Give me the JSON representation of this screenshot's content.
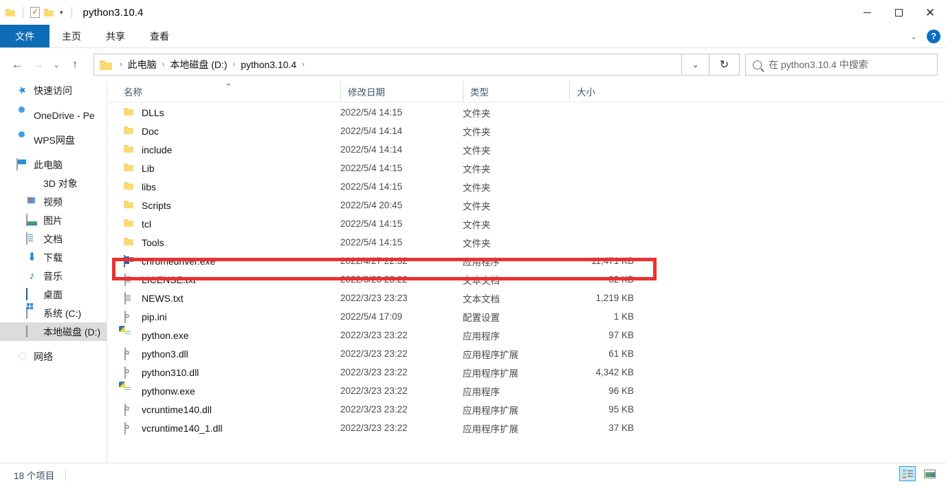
{
  "window": {
    "title": "python3.10.4",
    "quick_access": [
      {
        "name": "folder-icon",
        "label": ""
      },
      {
        "name": "properties-icon",
        "label": ""
      },
      {
        "name": "new-folder-icon",
        "label": ""
      },
      {
        "name": "customize-caret-icon",
        "label": "▾"
      }
    ],
    "controls": {
      "minimize": "—",
      "maximize": "▢",
      "close": "✕"
    }
  },
  "ribbon": {
    "tabs": [
      {
        "label": "文件",
        "active": true
      },
      {
        "label": "主页",
        "active": false
      },
      {
        "label": "共享",
        "active": false
      },
      {
        "label": "查看",
        "active": false
      }
    ],
    "expand_caret": "⌄",
    "help_label": "?"
  },
  "navigation": {
    "back": "←",
    "forward": "→",
    "recent": "⌄",
    "up": "↑",
    "breadcrumbs": [
      "此电脑",
      "本地磁盘 (D:)",
      "python3.10.4"
    ],
    "separator": "›",
    "address_caret": "⌄",
    "refresh": "↻"
  },
  "search": {
    "placeholder": "在 python3.10.4 中搜索"
  },
  "sidebar": {
    "items": [
      {
        "label": "快速访问",
        "icon": "star-icon",
        "indent": 0,
        "selected": false
      },
      {
        "label": "OneDrive - Pe",
        "icon": "onedrive-cloud-icon",
        "indent": 0,
        "selected": false
      },
      {
        "label": "WPS网盘",
        "icon": "wps-cloud-icon",
        "indent": 0,
        "selected": false
      },
      {
        "label": "此电脑",
        "icon": "this-pc-icon",
        "indent": 0,
        "selected": false
      },
      {
        "label": "3D 对象",
        "icon": "3d-objects-icon",
        "indent": 1,
        "selected": false
      },
      {
        "label": "视频",
        "icon": "videos-icon",
        "indent": 1,
        "selected": false
      },
      {
        "label": "图片",
        "icon": "pictures-icon",
        "indent": 1,
        "selected": false
      },
      {
        "label": "文档",
        "icon": "documents-icon",
        "indent": 1,
        "selected": false
      },
      {
        "label": "下载",
        "icon": "downloads-icon",
        "indent": 1,
        "selected": false
      },
      {
        "label": "音乐",
        "icon": "music-icon",
        "indent": 1,
        "selected": false
      },
      {
        "label": "桌面",
        "icon": "desktop-icon",
        "indent": 1,
        "selected": false
      },
      {
        "label": "系统 (C:)",
        "icon": "windows-drive-icon",
        "indent": 1,
        "selected": false
      },
      {
        "label": "本地磁盘 (D:)",
        "icon": "local-drive-icon",
        "indent": 1,
        "selected": true
      },
      {
        "label": "网络",
        "icon": "network-icon",
        "indent": 0,
        "selected": false
      }
    ]
  },
  "columns": [
    {
      "label": "名称",
      "sorted": "asc"
    },
    {
      "label": "修改日期",
      "sorted": null
    },
    {
      "label": "类型",
      "sorted": null
    },
    {
      "label": "大小",
      "sorted": null
    }
  ],
  "sort_caret": "⌃",
  "files": [
    {
      "name": "DLLs",
      "date": "2022/5/4 14:15",
      "type": "文件夹",
      "size": "",
      "icon": "folder-icon",
      "highlighted": false
    },
    {
      "name": "Doc",
      "date": "2022/5/4 14:14",
      "type": "文件夹",
      "size": "",
      "icon": "folder-icon",
      "highlighted": false
    },
    {
      "name": "include",
      "date": "2022/5/4 14:14",
      "type": "文件夹",
      "size": "",
      "icon": "folder-icon",
      "highlighted": false
    },
    {
      "name": "Lib",
      "date": "2022/5/4 14:15",
      "type": "文件夹",
      "size": "",
      "icon": "folder-icon",
      "highlighted": false
    },
    {
      "name": "libs",
      "date": "2022/5/4 14:15",
      "type": "文件夹",
      "size": "",
      "icon": "folder-icon",
      "highlighted": false
    },
    {
      "name": "Scripts",
      "date": "2022/5/4 20:45",
      "type": "文件夹",
      "size": "",
      "icon": "folder-icon",
      "highlighted": false
    },
    {
      "name": "tcl",
      "date": "2022/5/4 14:15",
      "type": "文件夹",
      "size": "",
      "icon": "folder-icon",
      "highlighted": false
    },
    {
      "name": "Tools",
      "date": "2022/5/4 14:15",
      "type": "文件夹",
      "size": "",
      "icon": "folder-icon",
      "highlighted": false
    },
    {
      "name": "chromedriver.exe",
      "date": "2022/4/27 22:32",
      "type": "应用程序",
      "size": "11,471 KB",
      "icon": "chromedriver-icon",
      "highlighted": true
    },
    {
      "name": "LICENSE.txt",
      "date": "2022/3/23 23:22",
      "type": "文本文档",
      "size": "32 KB",
      "icon": "text-file-icon",
      "highlighted": false
    },
    {
      "name": "NEWS.txt",
      "date": "2022/3/23 23:23",
      "type": "文本文档",
      "size": "1,219 KB",
      "icon": "text-file-icon",
      "highlighted": false
    },
    {
      "name": "pip.ini",
      "date": "2022/5/4 17:09",
      "type": "配置设置",
      "size": "1 KB",
      "icon": "ini-file-icon",
      "highlighted": false
    },
    {
      "name": "python.exe",
      "date": "2022/3/23 23:22",
      "type": "应用程序",
      "size": "97 KB",
      "icon": "python-exe-icon",
      "highlighted": false
    },
    {
      "name": "python3.dll",
      "date": "2022/3/23 23:22",
      "type": "应用程序扩展",
      "size": "61 KB",
      "icon": "dll-file-icon",
      "highlighted": false
    },
    {
      "name": "python310.dll",
      "date": "2022/3/23 23:22",
      "type": "应用程序扩展",
      "size": "4,342 KB",
      "icon": "dll-file-icon",
      "highlighted": false
    },
    {
      "name": "pythonw.exe",
      "date": "2022/3/23 23:22",
      "type": "应用程序",
      "size": "96 KB",
      "icon": "python-exe-icon",
      "highlighted": false
    },
    {
      "name": "vcruntime140.dll",
      "date": "2022/3/23 23:22",
      "type": "应用程序扩展",
      "size": "95 KB",
      "icon": "dll-file-icon",
      "highlighted": false
    },
    {
      "name": "vcruntime140_1.dll",
      "date": "2022/3/23 23:22",
      "type": "应用程序扩展",
      "size": "37 KB",
      "icon": "dll-file-icon",
      "highlighted": false
    }
  ],
  "status": {
    "item_count": "18 个项目"
  },
  "view_buttons": [
    {
      "name": "details-view-button",
      "active": true
    },
    {
      "name": "large-icons-view-button",
      "active": false
    }
  ],
  "colors": {
    "accent": "#0d6cb6",
    "highlight_box": "#ef2f2f",
    "selection": "#dcdcdc",
    "header_text": "#40546b"
  }
}
